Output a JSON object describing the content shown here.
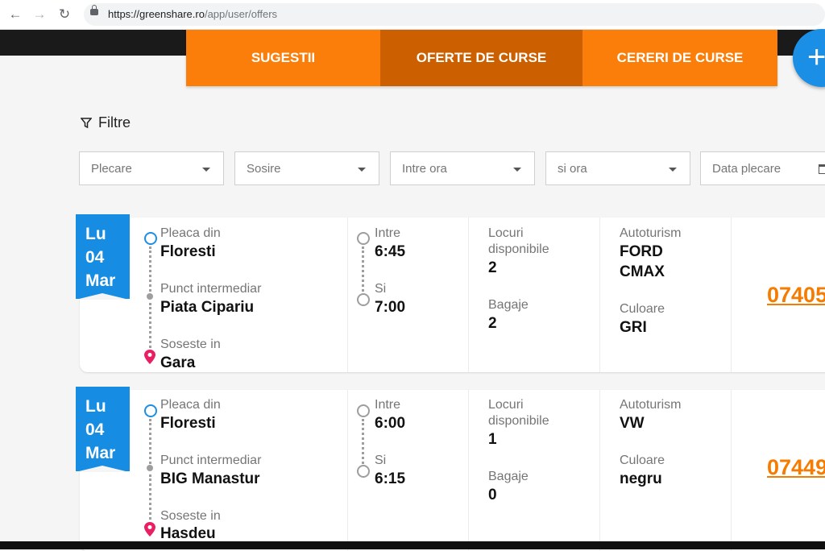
{
  "browser": {
    "url_host": "https://greenshare.ro",
    "url_path": "/app/user/offers"
  },
  "tabs": [
    {
      "label": "SUGESTII",
      "active": false
    },
    {
      "label": "OFERTE DE CURSE",
      "active": true
    },
    {
      "label": "CERERI DE CURSE",
      "active": false
    }
  ],
  "fab": {
    "label": "+"
  },
  "filters": {
    "title": "Filtre",
    "fields": [
      {
        "placeholder": "Plecare"
      },
      {
        "placeholder": "Sosire"
      },
      {
        "placeholder": "Intre ora"
      },
      {
        "placeholder": "si ora"
      },
      {
        "placeholder": "Data plecare"
      }
    ]
  },
  "labels": {
    "departure": "Pleaca din",
    "intermediate": "Punct intermediar",
    "arrival": "Soseste in",
    "between": "Intre",
    "and": "Si",
    "seats": "Locuri disponibile",
    "seats_line1": "Locuri",
    "seats_line2": "disponibile",
    "luggage": "Bagaje",
    "car": "Autoturism",
    "color": "Culoare"
  },
  "rides": [
    {
      "day": "Lu",
      "date": "04",
      "month": "Mar",
      "from": "Floresti",
      "via": "Piata Cipariu",
      "to": "Gara",
      "time_from": "6:45",
      "time_to": "7:00",
      "seats": "2",
      "luggage": "2",
      "car_line1": "FORD",
      "car_line2": "CMAX",
      "color": "GRI",
      "phone": "07405"
    },
    {
      "day": "Lu",
      "date": "04",
      "month": "Mar",
      "from": "Floresti",
      "via": "BIG Manastur",
      "to": "Hasdeu",
      "time_from": "6:00",
      "time_to": "6:15",
      "seats": "1",
      "luggage": "0",
      "car_line1": "VW",
      "car_line2": "",
      "color": "negru",
      "phone": "07449"
    }
  ],
  "colors": {
    "orange": "#fb7e0b",
    "orange_active": "#cc5f00",
    "blue": "#168de2",
    "phone": "#f57c00"
  }
}
